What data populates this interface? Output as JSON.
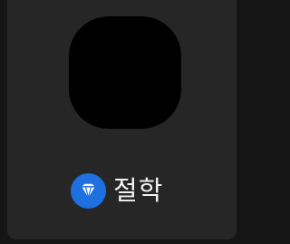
{
  "app": {
    "label": "절학",
    "icon": "app-icon-blank",
    "badge_icon": "diamond-icon"
  },
  "colors": {
    "background": "#151515",
    "tile": "#262626",
    "icon_fill": "#000000",
    "badge": "#1e6fe0",
    "label_text": "#f2f2f2"
  }
}
